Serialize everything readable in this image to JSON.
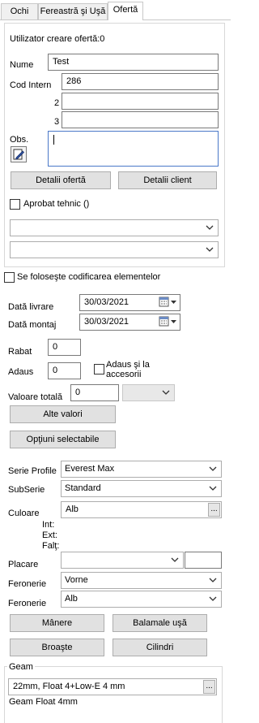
{
  "tabs": [
    {
      "label": "Ochi"
    },
    {
      "label": "Fereastră şi Uşă"
    },
    {
      "label": "Ofertă"
    }
  ],
  "offer": {
    "creator_label": "Utilizator creare ofertă:0",
    "name_label": "Nume",
    "name_value": "Test",
    "code_label": "Cod Intern",
    "code_value": "286",
    "code2_label": "2",
    "code2_value": "",
    "code3_label": "3",
    "code3_value": "",
    "obs_label": "Obs.",
    "obs_value": "",
    "details_offer_button": "Detalii ofertă",
    "details_client_button": "Detalii client",
    "approved_label": "Aprobat tehnic ()",
    "approved_checked": false,
    "select1_value": "",
    "select2_value": ""
  },
  "coding_label": "Se foloseşte codificarea elementelor",
  "coding_checked": false,
  "delivery_label": "Dată livrare",
  "delivery_value": "30/03/2021",
  "montage_label": "Dată montaj",
  "montage_value": "30/03/2021",
  "discount_label": "Rabat",
  "discount_value": "0",
  "addition_label": "Adaus",
  "addition_value": "0",
  "addition_accessories_label": "Adaus şi la accesorii",
  "addition_accessories_checked": false,
  "total_label": "Valoare totală",
  "total_value": "0",
  "total_currency": "",
  "other_values_button": "Alte valori",
  "selectable_options_button": "Opţiuni selectabile",
  "profile": {
    "series_label": "Serie Profile",
    "series_value": "Everest Max",
    "subseries_label": "SubSerie",
    "subseries_value": "Standard",
    "color_label": "Culoare",
    "color_value": "Alb",
    "int_label": "Int:",
    "ext_label": "Ext:",
    "falt_label": "Falţ:",
    "placare_label": "Placare",
    "placare_value": "",
    "placare_extra": "",
    "hardware1_label": "Feronerie",
    "hardware1_value": "Vorne",
    "hardware2_label": "Feronerie",
    "hardware2_value": "Alb"
  },
  "buttons": {
    "handles": "Mânere",
    "door_hinges": "Balamale uşă",
    "locks": "Broaşte",
    "cylinders": "Cilindri"
  },
  "glass": {
    "title": "Geam",
    "value": "22mm, Float 4+Low-E 4 mm",
    "subtitle": "Geam Float 4mm"
  },
  "icons": {
    "obs_edit": "edit-note-icon",
    "calendar": "calendar-icon",
    "dropdown": "chevron-down-icon",
    "browse": "ellipsis-icon"
  }
}
